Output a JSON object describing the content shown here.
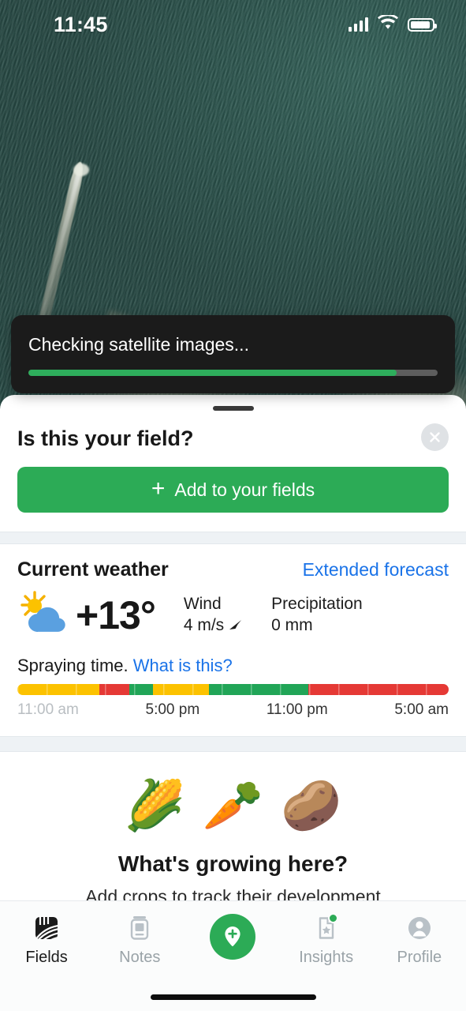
{
  "status_bar": {
    "time": "11:45",
    "signal_icon": "cellular-signal-icon",
    "wifi_icon": "wifi-icon",
    "battery_icon": "battery-icon"
  },
  "map": {
    "type": "satellite-imagery",
    "description": "aerial satellite view of a dark green field with a light diagonal track"
  },
  "toast": {
    "message": "Checking satellite images...",
    "progress_percent": 90,
    "progress_color": "#2eae5c",
    "background_color": "#1b1b1b"
  },
  "sheet": {
    "title": "Is this your field?",
    "close_label": "×",
    "add_button": {
      "plus": "+",
      "label": "Add to your fields",
      "color": "#2cab56"
    }
  },
  "weather": {
    "heading": "Current weather",
    "forecast_link": "Extended forecast",
    "link_color": "#1a73e8",
    "condition_icon": "sun-behind-cloud-icon",
    "temperature": "+13°",
    "wind": {
      "label": "Wind",
      "value": "4 m/s",
      "direction_icon": "wind-direction-arrow-icon"
    },
    "precipitation": {
      "label": "Precipitation",
      "value": "0 mm"
    }
  },
  "spraying": {
    "title": "Spraying time.",
    "help_link": "What is this?",
    "times": [
      "11:00 am",
      "5:00 pm",
      "11:00 pm",
      "5:00 am"
    ],
    "colors": {
      "bad": "#e53935",
      "good": "#21a557",
      "moderate": "#fcc200"
    },
    "segments": [
      {
        "status": "bad",
        "color": "#e53935",
        "width_percent": 32.5
      },
      {
        "status": "good",
        "color": "#21a557",
        "width_percent": 23.0
      },
      {
        "status": "moderate",
        "color": "#fcc200",
        "width_percent": 13.0
      },
      {
        "status": "good",
        "color": "#21a557",
        "width_percent": 5.5
      },
      {
        "status": "bad",
        "color": "#e53935",
        "width_percent": 7.0
      },
      {
        "status": "moderate",
        "color": "#fcc200",
        "width_percent": 19.0
      }
    ]
  },
  "crops": {
    "emojis": [
      "🌽",
      "🥕",
      "🥔"
    ],
    "heading": "What's growing here?",
    "subtitle": "Add crops to track their development"
  },
  "tabbar": {
    "items": [
      {
        "label": "Fields",
        "icon": "fields-icon",
        "active": true,
        "badge": false
      },
      {
        "label": "Notes",
        "icon": "notes-icon",
        "active": false,
        "badge": false
      },
      {
        "label": "",
        "icon": "add-field-pin-icon",
        "active": false,
        "badge": false
      },
      {
        "label": "Insights",
        "icon": "insights-icon",
        "active": false,
        "badge": true
      },
      {
        "label": "Profile",
        "icon": "profile-icon",
        "active": false,
        "badge": false
      }
    ]
  }
}
